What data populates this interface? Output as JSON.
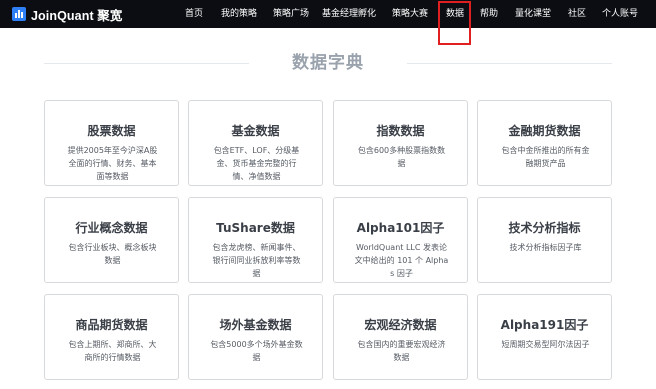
{
  "app": {
    "logo_text": "JoinQuant 聚宽"
  },
  "nav": {
    "items": [
      "首页",
      "我的策略",
      "策略广场",
      "基金经理孵化",
      "策略大赛",
      "数据",
      "帮助",
      "量化课堂",
      "社区",
      "个人账号"
    ]
  },
  "page": {
    "title": "数据字典"
  },
  "cards": [
    {
      "title": "股票数据",
      "desc": "提供2005年至今沪深A股全面的行情、财务、基本面等数据"
    },
    {
      "title": "基金数据",
      "desc": "包含ETF、LOF、分级基金、货币基金完整的行情、净值数据"
    },
    {
      "title": "指数数据",
      "desc": "包含600多种股票指数数据"
    },
    {
      "title": "金融期货数据",
      "desc": "包含中金所推出的所有金融期货产品"
    },
    {
      "title": "行业概念数据",
      "desc": "包含行业板块、概念板块数据"
    },
    {
      "title": "TuShare数据",
      "desc": "包含龙虎榜、新闻事件、银行间同业拆放利率等数据"
    },
    {
      "title": "Alpha101因子",
      "desc": "WorldQuant LLC 发表论文中给出的 101 个 Alphas 因子"
    },
    {
      "title": "技术分析指标",
      "desc": "技术分析指标因子库"
    },
    {
      "title": "商品期货数据",
      "desc": "包含上期所、郑商所、大商所的行情数据"
    },
    {
      "title": "场外基金数据",
      "desc": "包含5000多个场外基金数据"
    },
    {
      "title": "宏观经济数据",
      "desc": "包含国内的重要宏观经济数据"
    },
    {
      "title": "Alpha191因子",
      "desc": "短周期交易型阿尔法因子"
    }
  ]
}
